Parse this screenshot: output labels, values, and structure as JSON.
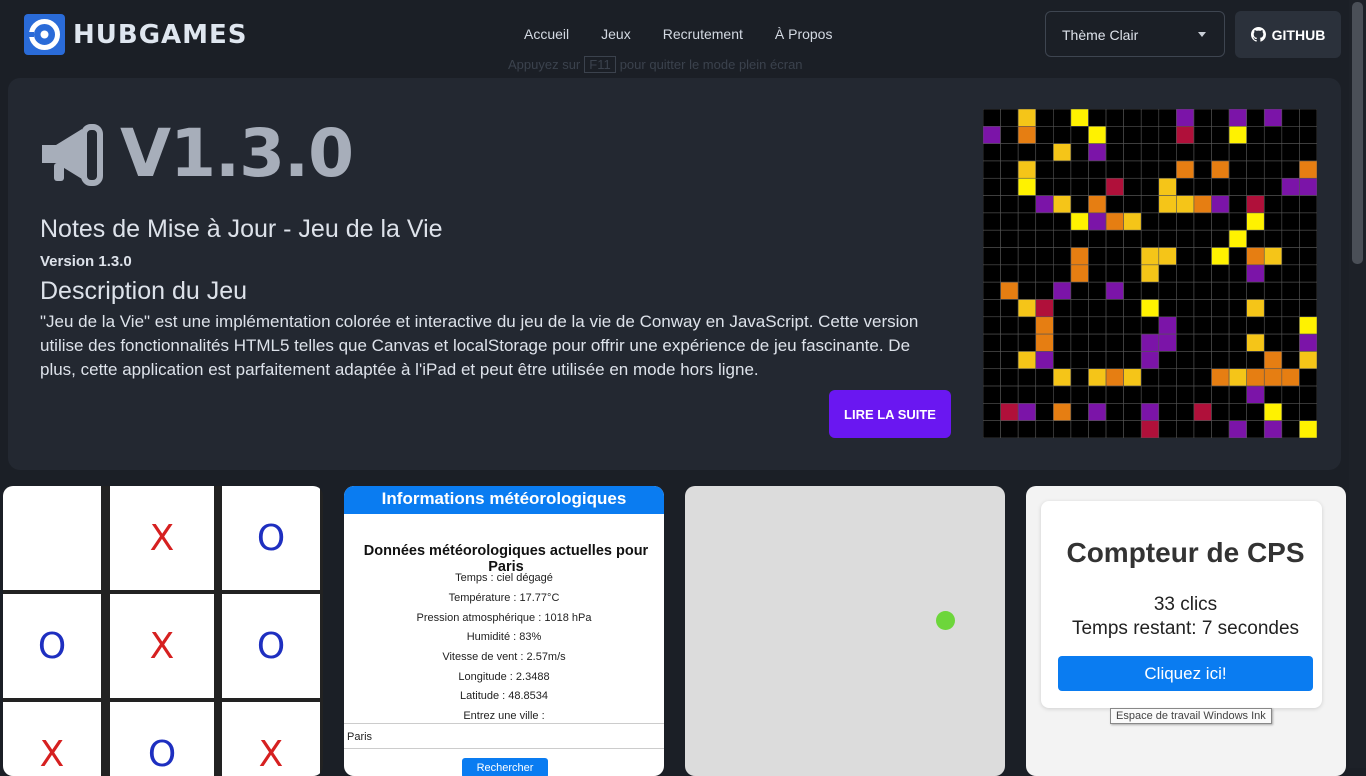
{
  "navbar": {
    "brand": "HUBGAMES",
    "links": [
      "Accueil",
      "Jeux",
      "Recrutement",
      "À Propos"
    ],
    "fullscreen_hint": {
      "before": "Appuyez sur",
      "key": "F11",
      "after": "pour quitter le mode plein écran"
    },
    "theme_select": "Thème Clair",
    "github_label": "GITHUB"
  },
  "hero": {
    "version": "V1.3.0",
    "title": "Notes de Mise à Jour - Jeu de la Vie",
    "version_line": "Version 1.3.0",
    "desc_title": "Description du Jeu",
    "description": "\"Jeu de la Vie\" est une implémentation colorée et interactive du jeu de la vie de Conway en JavaScript. Cette version utilise des fonctionnalités HTML5 telles que Canvas et localStorage pour offrir une expérience de jeu fascinante. De plus, cette application est parfaitement adaptée à l'iPad et peut être utilisée en mode hors ligne.",
    "read_more": "LIRE LA SUITE"
  },
  "tictactoe": {
    "cells": [
      "",
      "X",
      "O",
      "O",
      "X",
      "O",
      "X",
      "O",
      "X"
    ]
  },
  "weather": {
    "header": "Informations météorologiques",
    "title": "Données météorologiques actuelles pour Paris",
    "lines": [
      "Temps : ciel dégagé",
      "Température : 17.77°C",
      "Pression atmosphérique : 1018 hPa",
      "Humidité : 83%",
      "Vitesse de vent : 2.57m/s",
      "Longitude : 2.3488",
      "Latitude : 48.8534",
      "Entrez une ville :"
    ],
    "city_value": "Paris",
    "button": "Rechercher"
  },
  "cps": {
    "title": "Compteur de CPS",
    "clicks": "33 clics",
    "time_left": "Temps restant: 7 secondes",
    "button": "Cliquez ici!"
  },
  "tooltip": "Espace de travail Windows Ink",
  "colors": {
    "accent_purple": "#6a17f1",
    "logo_blue": "#2a6bd8",
    "weather_blue": "#0a7cf1",
    "ball_green": "#6dd63b"
  }
}
